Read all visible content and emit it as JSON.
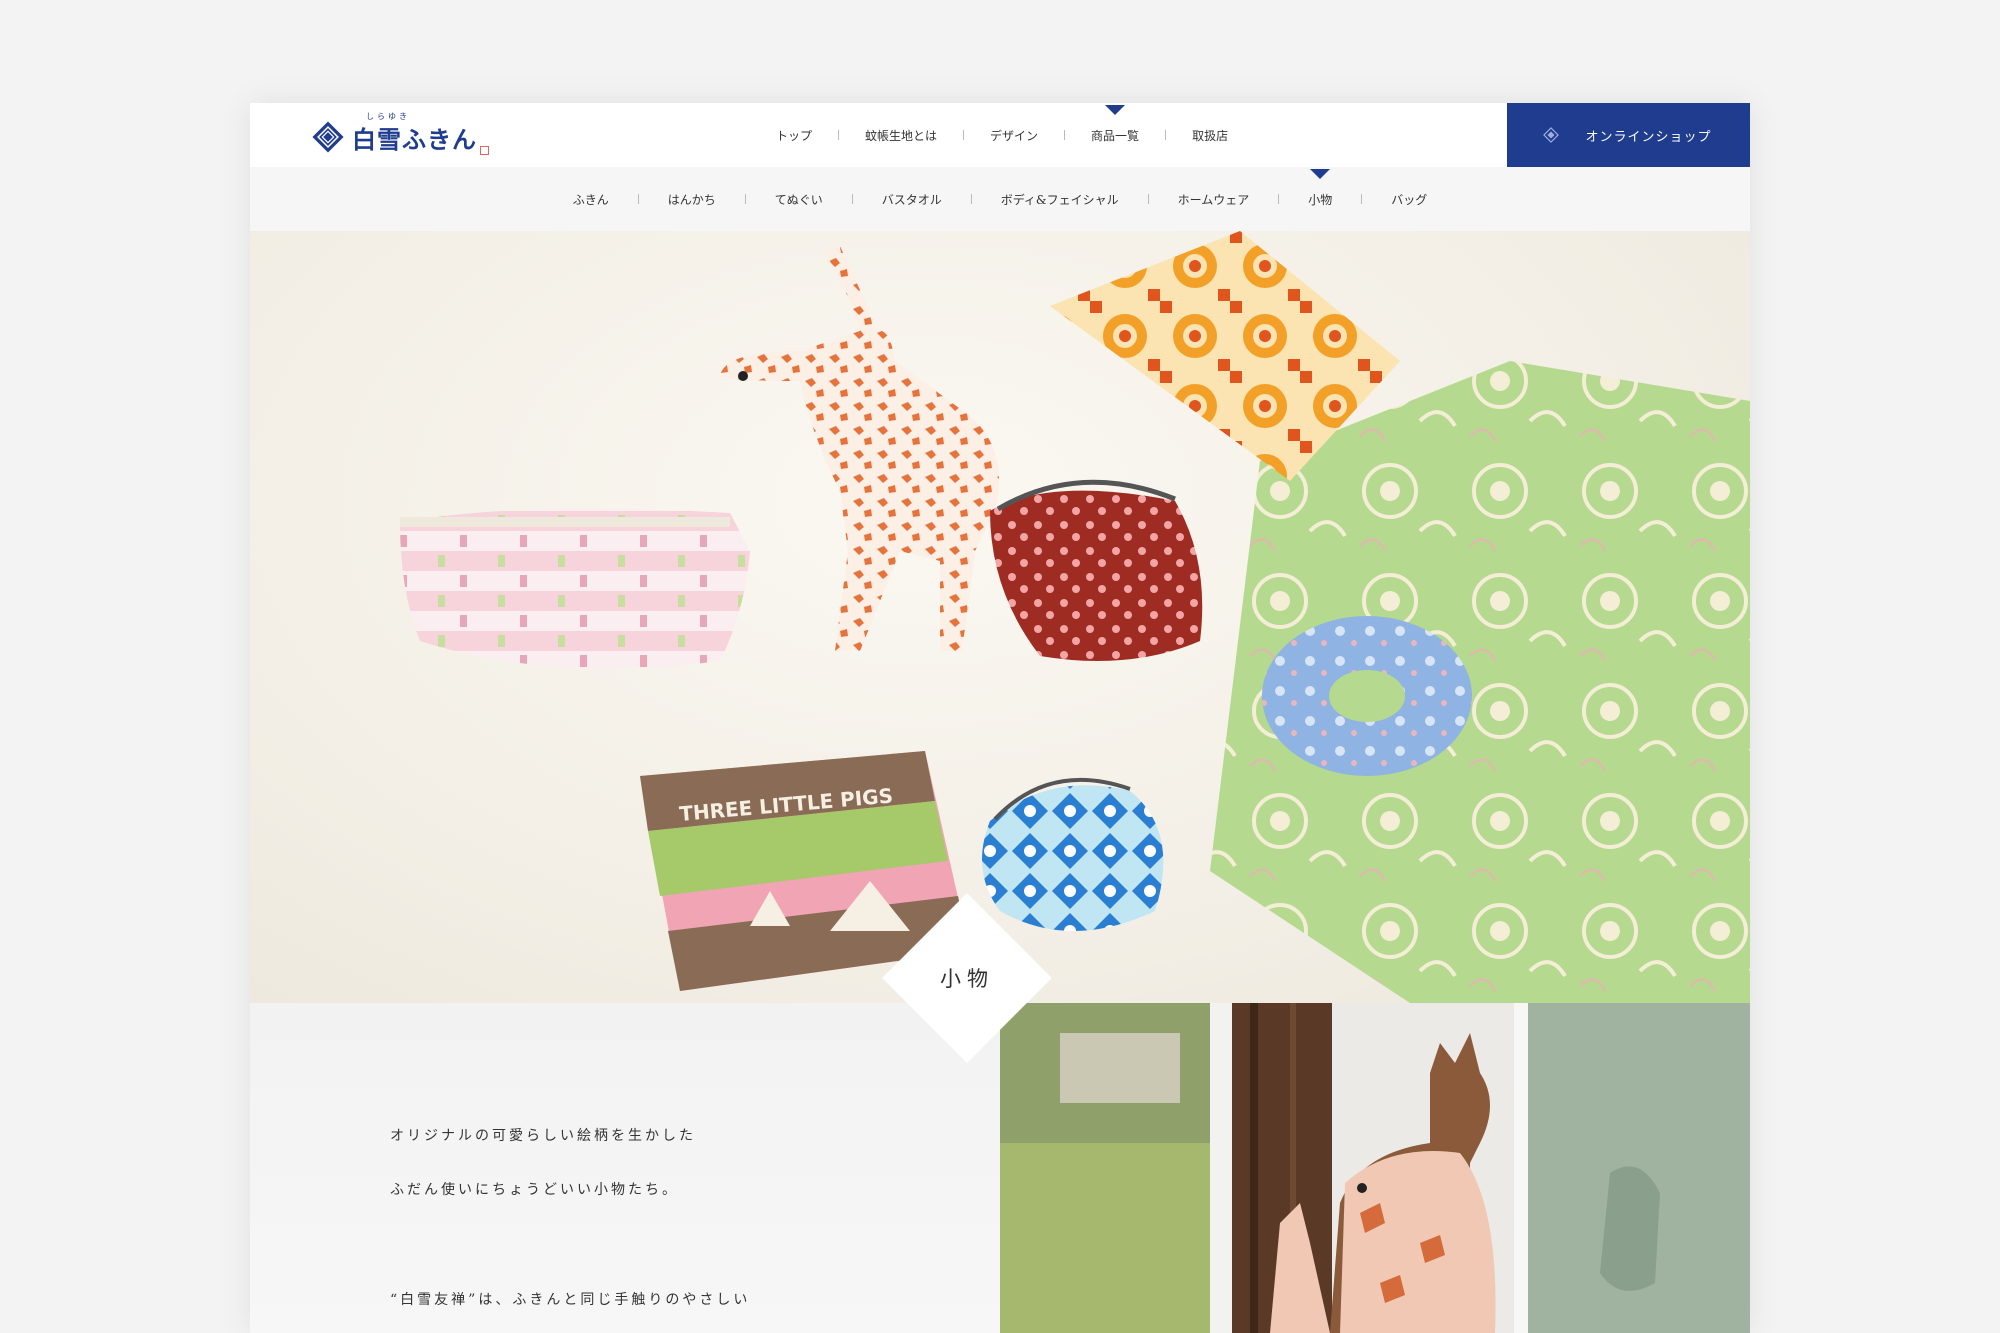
{
  "brand": {
    "name": "白雪ふきん",
    "ruby": "しらゆき"
  },
  "main_nav": [
    {
      "label": "トップ",
      "active": false
    },
    {
      "label": "蚊帳生地とは",
      "active": false
    },
    {
      "label": "デザイン",
      "active": false
    },
    {
      "label": "商品一覧",
      "active": true
    },
    {
      "label": "取扱店",
      "active": false
    }
  ],
  "shop_button": {
    "label": "オンラインショップ"
  },
  "sub_nav": [
    {
      "label": "ふきん",
      "active": false
    },
    {
      "label": "はんかち",
      "active": false
    },
    {
      "label": "てぬぐい",
      "active": false
    },
    {
      "label": "バスタオル",
      "active": false
    },
    {
      "label": "ボディ&フェイシャル",
      "active": false
    },
    {
      "label": "ホームウェア",
      "active": false
    },
    {
      "label": "小物",
      "active": true
    },
    {
      "label": "バッグ",
      "active": false
    }
  ],
  "hero": {
    "product_text": "THREE LITTLE PIGS"
  },
  "section": {
    "title": "小物",
    "lines": [
      "オリジナルの可愛らしい絵柄を生かした",
      "ふだん使いにちょうどいい小物たち。",
      "“白雪友禅”は、ふきんと同じ手触りのやさしい"
    ]
  },
  "colors": {
    "brand_blue": "#1f3c8f",
    "subnav_bg": "#f6f6f6"
  }
}
